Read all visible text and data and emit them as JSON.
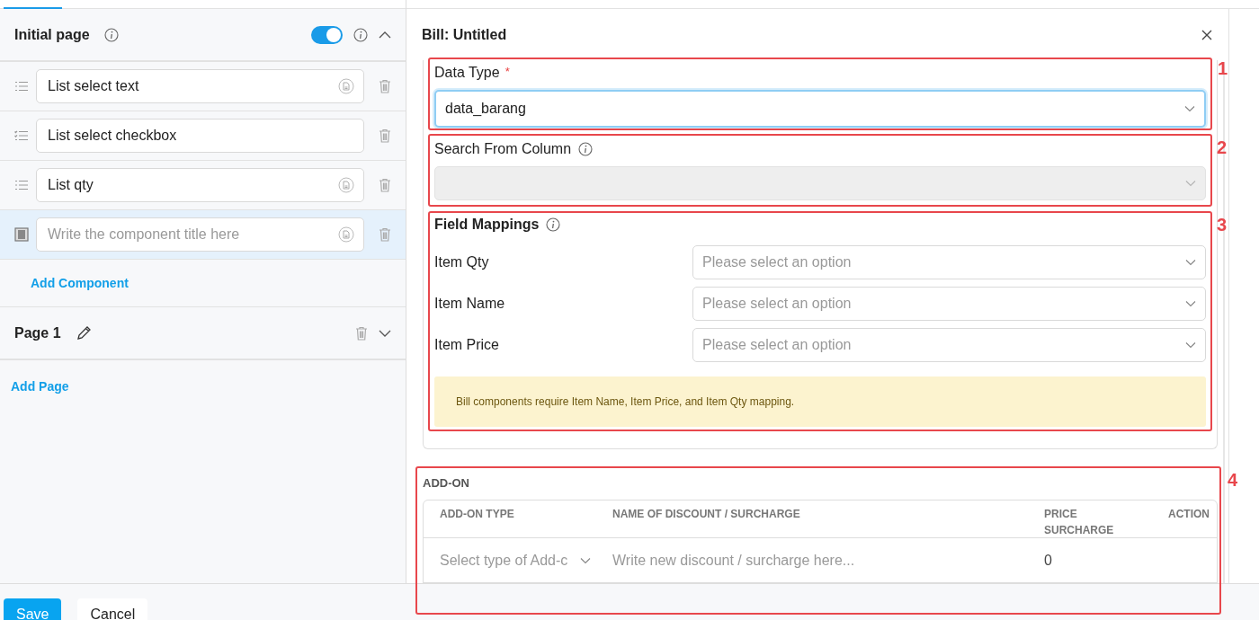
{
  "sidebar": {
    "pages": [
      {
        "title": "Initial page",
        "kind": "initial",
        "enabled": true,
        "expanded": true,
        "components": [
          {
            "kind": "list",
            "value": "List select text",
            "doc_icon": true,
            "selected": false
          },
          {
            "kind": "checklist",
            "value": "List select checkbox",
            "doc_icon": false,
            "selected": false
          },
          {
            "kind": "list",
            "value": "List qty",
            "doc_icon": true,
            "selected": false
          },
          {
            "kind": "block",
            "placeholder": "Write the component title here",
            "doc_icon": true,
            "selected": true
          }
        ],
        "add_component": "Add Component"
      },
      {
        "title": "Page 1",
        "kind": "page",
        "expanded": false
      }
    ],
    "add_page": "Add Page"
  },
  "dialog": {
    "title": "Bill: Untitled",
    "data_type": {
      "label": "Data Type",
      "required_mark": "*",
      "value": "data_barang",
      "focused": true
    },
    "search_column": {
      "label": "Search From Column",
      "disabled": true
    },
    "field_mappings": {
      "title": "Field Mappings",
      "rows": [
        {
          "label": "Item Qty",
          "placeholder": "Please select an option"
        },
        {
          "label": "Item Name",
          "placeholder": "Please select an option"
        },
        {
          "label": "Item Price",
          "placeholder": "Please select an option"
        }
      ]
    },
    "notice": "Bill components require Item Name, Item Price, and Item Qty mapping.",
    "addon": {
      "title": "ADD-ON",
      "columns": [
        "ADD-ON TYPE",
        "NAME OF DISCOUNT / SURCHARGE",
        "PRICE SURCHARGE",
        "ACTION"
      ],
      "rows": [
        {
          "type_placeholder": "Select type of Add-c",
          "name_placeholder": "Write new discount / surcharge here...",
          "price": "0"
        }
      ]
    }
  },
  "annotations": [
    "1",
    "2",
    "3",
    "4"
  ],
  "footer": {
    "buttons": [
      {
        "label": "Save",
        "kind": "primary"
      },
      {
        "label": "Cancel",
        "kind": "secondary"
      }
    ]
  }
}
